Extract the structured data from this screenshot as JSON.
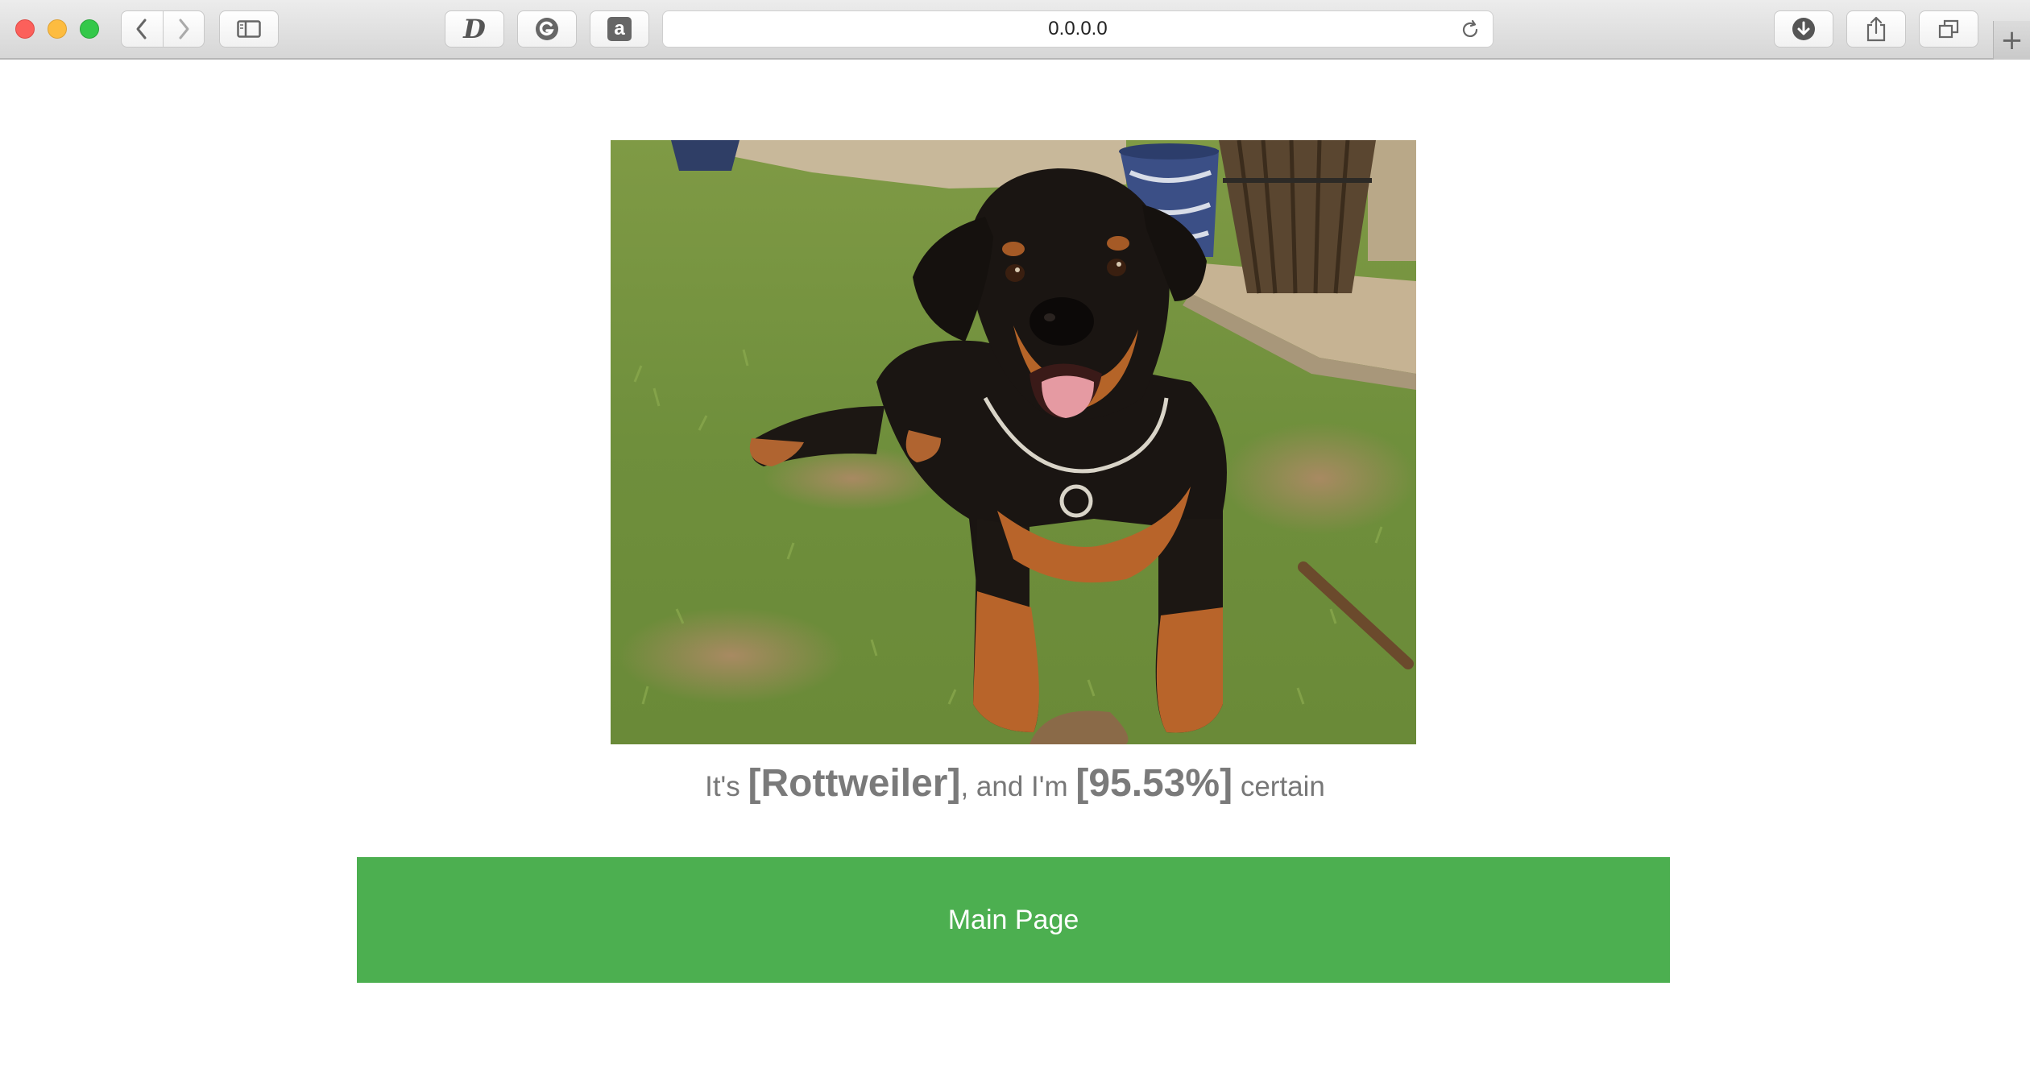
{
  "browser": {
    "url": "0.0.0.0",
    "icons": {
      "back": "chevron-left-icon",
      "forward": "chevron-right-icon",
      "sidebar": "sidebar-icon",
      "extension_d": "d-extension-icon",
      "extension_g": "grammarly-icon",
      "extension_a": "amazon-icon",
      "reload": "reload-icon",
      "download": "download-icon",
      "share": "share-icon",
      "tabs": "tabs-icon",
      "new_tab": "plus-icon"
    },
    "extension_labels": {
      "d": "D",
      "a": "a"
    },
    "new_tab_glyph": "+"
  },
  "result": {
    "prefix": "It's ",
    "breed": "[Rottweiler]",
    "middle": ", and I'm ",
    "confidence": "[95.53%]",
    "suffix": " certain"
  },
  "main_button": {
    "label": "Main Page",
    "color": "#4caf50"
  },
  "colors": {
    "caption_text": "#777777",
    "button_text": "#ffffff"
  }
}
